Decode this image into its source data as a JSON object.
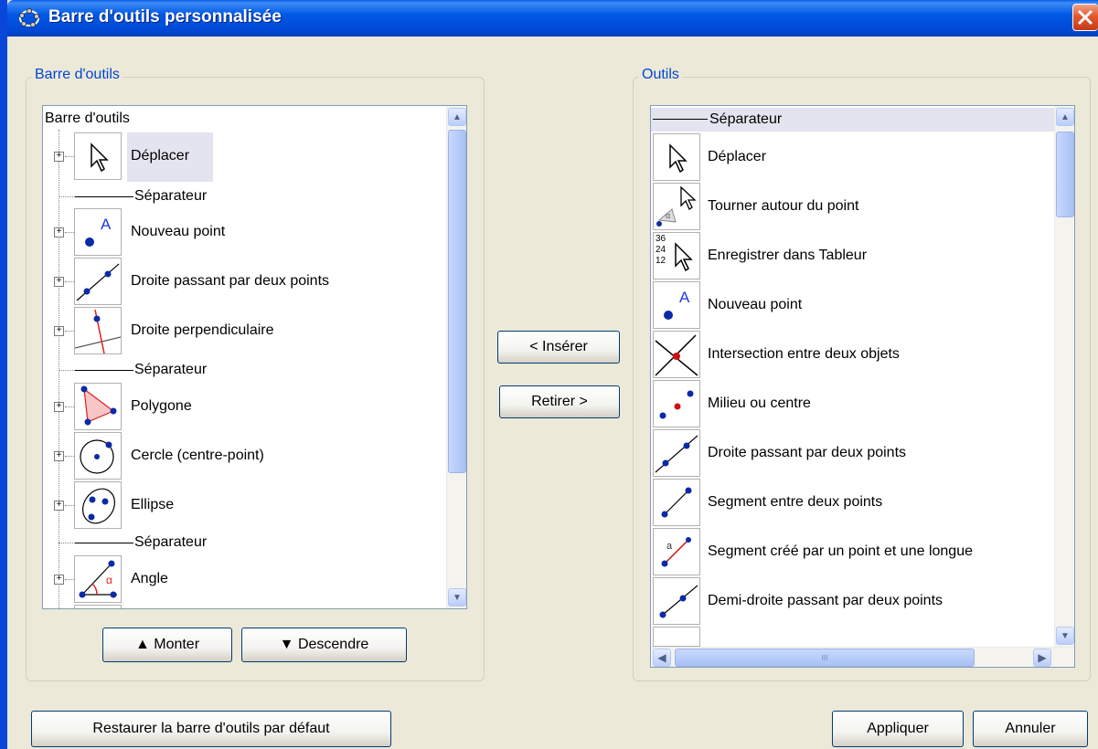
{
  "window": {
    "title": "Barre d'outils personnalisée"
  },
  "left_panel": {
    "legend": "Barre d'outils",
    "root_label": "Barre d'outils",
    "items": [
      {
        "label": "Déplacer",
        "icon": "move-arrow-icon"
      },
      {
        "label": "Séparateur",
        "icon": "separator"
      },
      {
        "label": "Nouveau point",
        "icon": "new-point-icon"
      },
      {
        "label": "Droite passant par deux points",
        "icon": "line-two-points-icon"
      },
      {
        "label": "Droite perpendiculaire",
        "icon": "perpendicular-line-icon"
      },
      {
        "label": "Séparateur",
        "icon": "separator"
      },
      {
        "label": "Polygone",
        "icon": "polygon-icon"
      },
      {
        "label": "Cercle (centre-point)",
        "icon": "circle-center-point-icon"
      },
      {
        "label": "Ellipse",
        "icon": "ellipse-icon"
      },
      {
        "label": "Séparateur",
        "icon": "separator"
      },
      {
        "label": "Angle",
        "icon": "angle-icon"
      }
    ],
    "up_button": "▲ Monter",
    "down_button": "▼ Descendre"
  },
  "middle": {
    "insert_button": "< Insérer",
    "remove_button": "Retirer >"
  },
  "right_panel": {
    "legend": "Outils",
    "items": [
      {
        "label": "Séparateur",
        "icon": "separator"
      },
      {
        "label": "Déplacer",
        "icon": "move-arrow-icon"
      },
      {
        "label": "Tourner autour du point",
        "icon": "rotate-around-point-icon"
      },
      {
        "label": "Enregistrer dans Tableur",
        "icon": "record-to-spreadsheet-icon",
        "icon_text": "36 24 12"
      },
      {
        "label": "Nouveau point",
        "icon": "new-point-icon"
      },
      {
        "label": "Intersection entre deux objets",
        "icon": "intersection-icon"
      },
      {
        "label": "Milieu ou centre",
        "icon": "midpoint-icon"
      },
      {
        "label": "Droite passant par deux points",
        "icon": "line-two-points-icon"
      },
      {
        "label": "Segment entre deux points",
        "icon": "segment-icon"
      },
      {
        "label": "Segment créé par un point et une longue",
        "icon": "segment-fixed-length-icon"
      },
      {
        "label": "Demi-droite passant par deux points",
        "icon": "ray-icon"
      }
    ],
    "scroll_left_glyph": "◀",
    "scroll_right_glyph": "▶",
    "hthumb_grip": "III"
  },
  "footer": {
    "restore_button": "Restaurer la barre d'outils par défaut",
    "apply_button": "Appliquer",
    "cancel_button": "Annuler"
  },
  "colors": {
    "title_bar": "#0058E6",
    "legend": "#0046D5",
    "close": "#E45A2E",
    "point": "#0A2AA8"
  }
}
